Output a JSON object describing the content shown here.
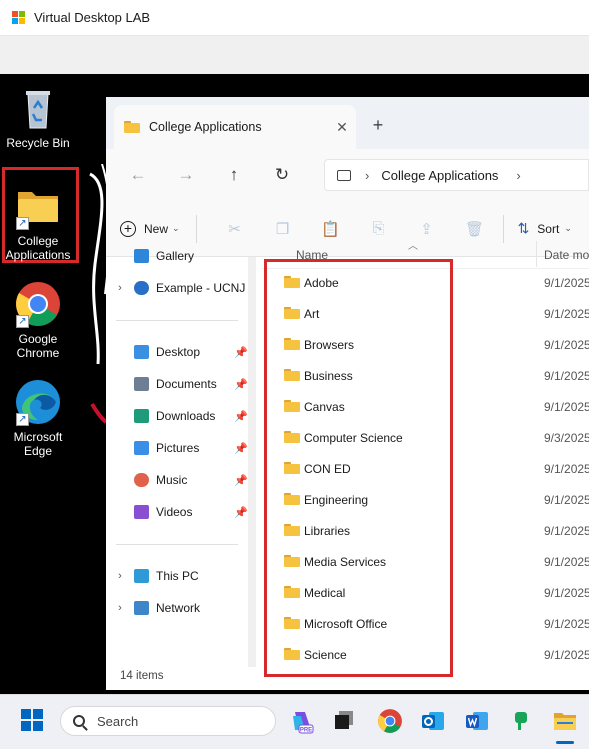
{
  "window": {
    "title": "Virtual Desktop LAB"
  },
  "desktop": {
    "icons": [
      {
        "label": "Recycle Bin",
        "icon": "recycle-bin-icon"
      },
      {
        "label": "College Applications",
        "icon": "folder-shortcut-icon"
      },
      {
        "label": "Google Chrome",
        "icon": "chrome-icon"
      },
      {
        "label": "Microsoft Edge",
        "icon": "edge-icon"
      }
    ]
  },
  "explorer": {
    "tab_title": "College Applications",
    "address": {
      "path": "College Applications"
    },
    "commands": {
      "new_label": "New",
      "sort_label": "Sort"
    },
    "nav": {
      "gallery": "Gallery",
      "onedrive": "Example - UCNJ",
      "quick": [
        {
          "label": "Desktop"
        },
        {
          "label": "Documents"
        },
        {
          "label": "Downloads"
        },
        {
          "label": "Pictures"
        },
        {
          "label": "Music"
        },
        {
          "label": "Videos"
        }
      ],
      "this_pc": "This PC",
      "network": "Network"
    },
    "columns": {
      "name": "Name",
      "date": "Date mo"
    },
    "files": [
      {
        "name": "Adobe",
        "date": "9/1/2025"
      },
      {
        "name": "Art",
        "date": "9/1/2025"
      },
      {
        "name": "Browsers",
        "date": "9/1/2025"
      },
      {
        "name": "Business",
        "date": "9/1/2025"
      },
      {
        "name": "Canvas",
        "date": "9/1/2025"
      },
      {
        "name": "Computer Science",
        "date": "9/3/2025"
      },
      {
        "name": "CON ED",
        "date": "9/1/2025"
      },
      {
        "name": "Engineering",
        "date": "9/1/2025"
      },
      {
        "name": "Libraries",
        "date": "9/1/2025"
      },
      {
        "name": "Media Services",
        "date": "9/1/2025"
      },
      {
        "name": "Medical",
        "date": "9/1/2025"
      },
      {
        "name": "Microsoft Office",
        "date": "9/1/2025"
      },
      {
        "name": "Science",
        "date": "9/1/2025"
      }
    ],
    "status": "14 items"
  },
  "taskbar": {
    "search_placeholder": "Search",
    "copilot_badge": "PRE"
  },
  "colors": {
    "highlight": "#d62a2a",
    "folder": "#f5c33f",
    "accent": "#0067c0"
  }
}
